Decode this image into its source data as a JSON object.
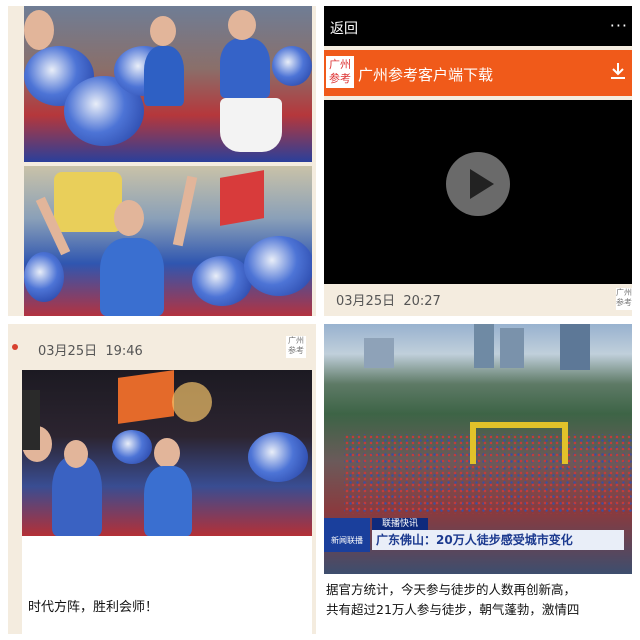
{
  "panel_top_left": {
    "photos": [
      "cheerleaders-with-pompoms",
      "smiling-man-cheering"
    ]
  },
  "panel_top_right": {
    "topbar": {
      "back_label": "返回",
      "more_label": "···"
    },
    "banner": {
      "logo_text": "广州参考",
      "text": "广州参考客户端下载",
      "icon": "download-icon"
    },
    "video": {
      "icon": "play-icon"
    },
    "timestamp": {
      "date": "03月25日",
      "time": "20:27"
    },
    "source_icon_text": "广州参考"
  },
  "panel_bottom_left": {
    "timestamp": {
      "date": "03月25日",
      "time": "19:46"
    },
    "source_icon_text": "广州参考",
    "caption": "时代方阵，胜利会师！"
  },
  "panel_bottom_right": {
    "news": {
      "flash_label": "联播快讯",
      "logo_text": "新闻联播",
      "headline": "广东佛山：20万人徒步感受城市变化"
    },
    "body_line1": "据官方统计，今天参与徒步的人数再创新高，",
    "body_line2": "共有超过21万人参与徒步，朝气蓬勃，激情四"
  },
  "colors": {
    "accent_orange": "#f05a1a",
    "cream": "#f4ecdf",
    "news_blue": "#1c3a8f"
  }
}
